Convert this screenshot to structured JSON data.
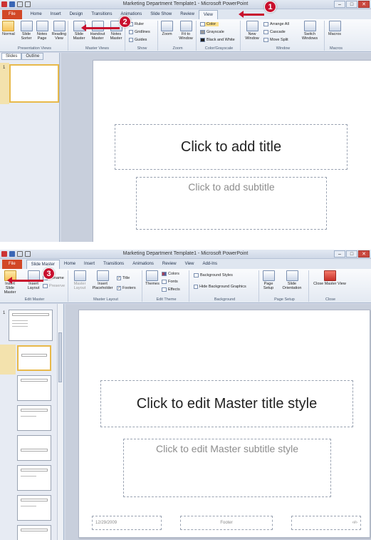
{
  "panel1": {
    "window_title": "Marketing Department Template1 - Microsoft PowerPoint",
    "tabs": [
      "File",
      "Home",
      "Insert",
      "Design",
      "Transitions",
      "Animations",
      "Slide Show",
      "Review",
      "View"
    ],
    "active_tab": "View",
    "ribbon": {
      "presentation_views": {
        "label": "Presentation Views",
        "buttons": [
          "Normal",
          "Slide Sorter",
          "Notes Page",
          "Reading View"
        ]
      },
      "master_views": {
        "label": "Master Views",
        "buttons": [
          "Slide Master",
          "Handout Master",
          "Notes Master"
        ]
      },
      "show": {
        "label": "Show",
        "items": [
          "Ruler",
          "Gridlines",
          "Guides"
        ]
      },
      "zoom": {
        "label": "Zoom",
        "buttons": [
          "Zoom",
          "Fit to Window"
        ]
      },
      "color": {
        "label": "Color/Grayscale",
        "items": [
          "Color",
          "Grayscale",
          "Black and White"
        ]
      },
      "window": {
        "label": "Window",
        "new_window": "New Window",
        "items": [
          "Arrange All",
          "Cascade",
          "Move Split"
        ],
        "switch": "Switch Windows"
      },
      "macros": {
        "label": "Macros",
        "button": "Macros"
      }
    },
    "pane_tabs": [
      "Slides",
      "Outline"
    ],
    "slide_number": "1",
    "title_placeholder": "Click to add title",
    "subtitle_placeholder": "Click to add subtitle",
    "callouts": [
      "1",
      "2"
    ]
  },
  "panel2": {
    "window_title": "Marketing Department Template1 - Microsoft PowerPoint",
    "tabs": [
      "File",
      "Slide Master",
      "Home",
      "Insert",
      "Transitions",
      "Animations",
      "Review",
      "View",
      "Add-Ins"
    ],
    "active_tab": "Slide Master",
    "ribbon": {
      "edit_master": {
        "label": "Edit Master",
        "buttons": [
          "Insert Slide Master",
          "Insert Layout"
        ],
        "small": [
          "Rename",
          "Preserve"
        ]
      },
      "master_layout": {
        "label": "Master Layout",
        "buttons": [
          "Master Layout",
          "Insert Placeholder"
        ],
        "checks": [
          "Title",
          "Footers"
        ]
      },
      "edit_theme": {
        "label": "Edit Theme",
        "themes": "Themes",
        "items": [
          "Colors",
          "Fonts",
          "Effects"
        ]
      },
      "background": {
        "label": "Background",
        "items": [
          "Background Styles",
          "Hide Background Graphics"
        ]
      },
      "page_setup": {
        "label": "Page Setup",
        "buttons": [
          "Page Setup",
          "Slide Orientation"
        ]
      },
      "close": {
        "label": "Close",
        "button": "Close Master View"
      }
    },
    "slide_number": "1",
    "title_placeholder": "Click to edit Master title style",
    "subtitle_placeholder": "Click to edit Master subtitle style",
    "footer_date": "12/29/2009",
    "footer_text": "Footer",
    "callouts": [
      "3"
    ],
    "colors": {
      "accent_red": "#c8102e",
      "file_tab": "#d24726",
      "selection": "#e8b94a"
    }
  }
}
